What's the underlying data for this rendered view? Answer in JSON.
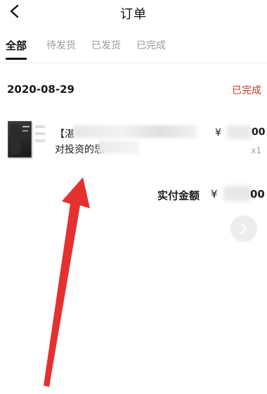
{
  "header": {
    "title": "订单",
    "back_icon": "chevron-left-icon"
  },
  "tabs": [
    {
      "label": "全部",
      "active": true
    },
    {
      "label": "待发货",
      "active": false
    },
    {
      "label": "已发货",
      "active": false
    },
    {
      "label": "已完成",
      "active": false
    }
  ],
  "order": {
    "date": "2020-08-29",
    "status": "已完成",
    "status_color": "#c0392b",
    "product": {
      "title_line1_visible": "【湛",
      "title_line2_visible": "对投资的思",
      "price_symbol": "¥",
      "price_visible_tail": "00",
      "quantity": "x1"
    },
    "total": {
      "label": "实付金额",
      "symbol": "¥",
      "visible_tail": "00"
    }
  },
  "floating_button": {
    "icon": "chevron-right-icon"
  },
  "annotation": {
    "arrow_color": "#e53030"
  }
}
